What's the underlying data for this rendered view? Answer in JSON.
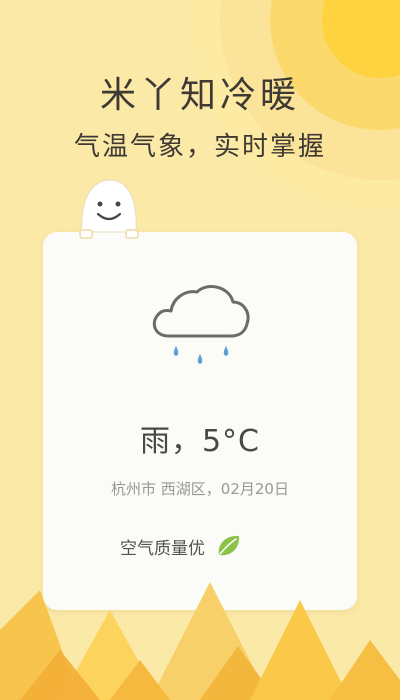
{
  "headline": {
    "title": "米丫知冷暖",
    "subtitle": "气温气象，实时掌握"
  },
  "weather": {
    "condition_icon": "rain-cloud-icon",
    "temperature_text": "雨，5°C",
    "location_date": "杭州市 西湖区，02月20日",
    "air_quality": "空气质量优",
    "air_quality_icon": "leaf-icon"
  },
  "colors": {
    "background": "#fbe9a8",
    "sun": "#ffd23f",
    "card": "#fbfbf8",
    "rain_drop": "#5aa0d8",
    "leaf": "#8bc34a"
  }
}
